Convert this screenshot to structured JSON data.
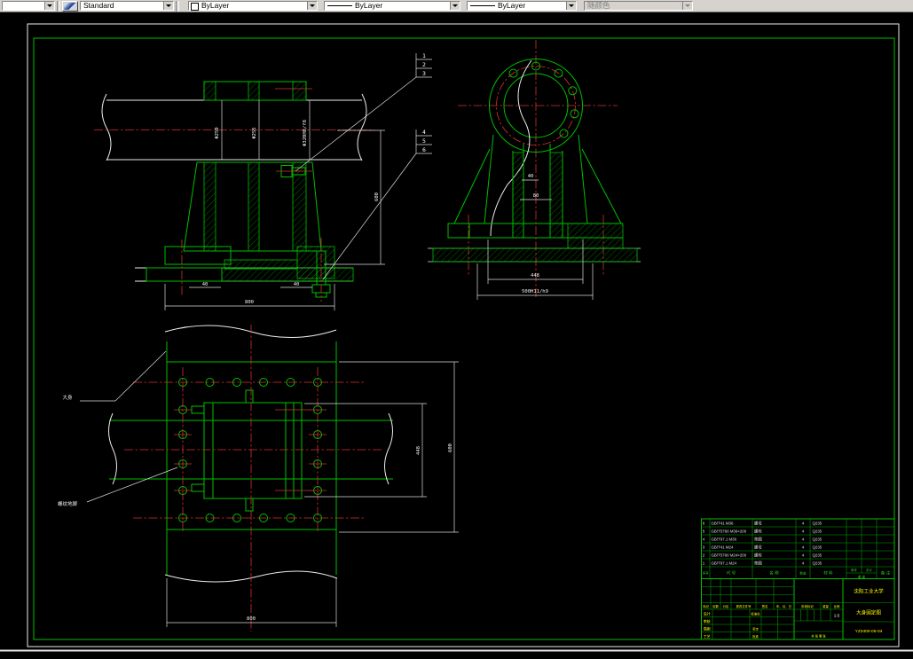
{
  "toolbar": {
    "combos": [
      {
        "id": "layer",
        "value": ""
      },
      {
        "id": "text_style",
        "value": "Standard"
      },
      {
        "id": "color",
        "value": "ByLayer"
      },
      {
        "id": "linetype",
        "value": "ByLayer"
      },
      {
        "id": "lineweight",
        "value": "ByLayer"
      },
      {
        "id": "plot_style",
        "value": "随颜色",
        "disabled": true
      }
    ]
  },
  "colors": {
    "background": "#000000",
    "outline_green": "#00bf00",
    "centerline_red": "#d43030",
    "dimension_white": "#ececec",
    "titleblock_yellow": "#ffff00",
    "toolbar_gray": "#d6d3ce"
  },
  "front_view": {
    "dim_bore_left": "Φ250",
    "dim_bore_mid": "Φ255",
    "dim_fit": "Φ320H8/f8",
    "dim_height": "600",
    "dim_foot_left": "40",
    "dim_foot_right": "40",
    "dim_width": "800",
    "callout_group_top": [
      "1",
      "2",
      "3"
    ],
    "callout_group_bottom": [
      "4",
      "5",
      "6"
    ]
  },
  "side_view": {
    "dim_slot": "40",
    "dim_web": "80",
    "dim_bolt_span": "448",
    "dim_base_fit": "500H11/h9"
  },
  "plan_view": {
    "label_body": "大身",
    "label_anchor": "螺纹地脚",
    "dim_block": "448",
    "dim_flange": "600",
    "dim_width": "800"
  },
  "bom": {
    "headers": {
      "no": "序号",
      "code": "代 号",
      "name": "名 称",
      "qty": "数量",
      "material": "材 料",
      "unit": "单件",
      "total": "总计",
      "weight": "重 量",
      "remark": "备 注"
    },
    "rows": [
      {
        "no": "6",
        "code": "GB/T41 M36",
        "name": "螺母",
        "qty": "4",
        "material": "Q235"
      },
      {
        "no": "5",
        "code": "GB/T5780 M36×200",
        "name": "螺栓",
        "qty": "4",
        "material": "Q235"
      },
      {
        "no": "4",
        "code": "GB/T97.1 M36",
        "name": "垫圈",
        "qty": "4",
        "material": "Q235"
      },
      {
        "no": "3",
        "code": "GB/T41 M24",
        "name": "螺母",
        "qty": "4",
        "material": "Q235"
      },
      {
        "no": "2",
        "code": "GB/T5780 M24×200",
        "name": "螺栓",
        "qty": "4",
        "material": "Q235"
      },
      {
        "no": "1",
        "code": "GB/T97.1 M24",
        "name": "垫圈",
        "qty": "4",
        "material": "Q235"
      }
    ]
  },
  "titleblock": {
    "revision_header": [
      "标记",
      "处数",
      "分区",
      "更改文件号",
      "签名",
      "年、月、日"
    ],
    "roles": [
      {
        "left": "设计",
        "mid": "标准化"
      },
      {
        "left": "审核",
        "mid": ""
      },
      {
        "left": "描图",
        "mid": "审定"
      },
      {
        "left": "工艺",
        "mid": "批准"
      }
    ],
    "stage_header": [
      "阶段标记",
      "重量",
      "比例"
    ],
    "scale": "1:5",
    "sheet_note": "共 张 第 张",
    "university": "沈阳工业大学",
    "drawing_title": "大身固定图",
    "drawing_no": "YZ3400-05-04"
  }
}
